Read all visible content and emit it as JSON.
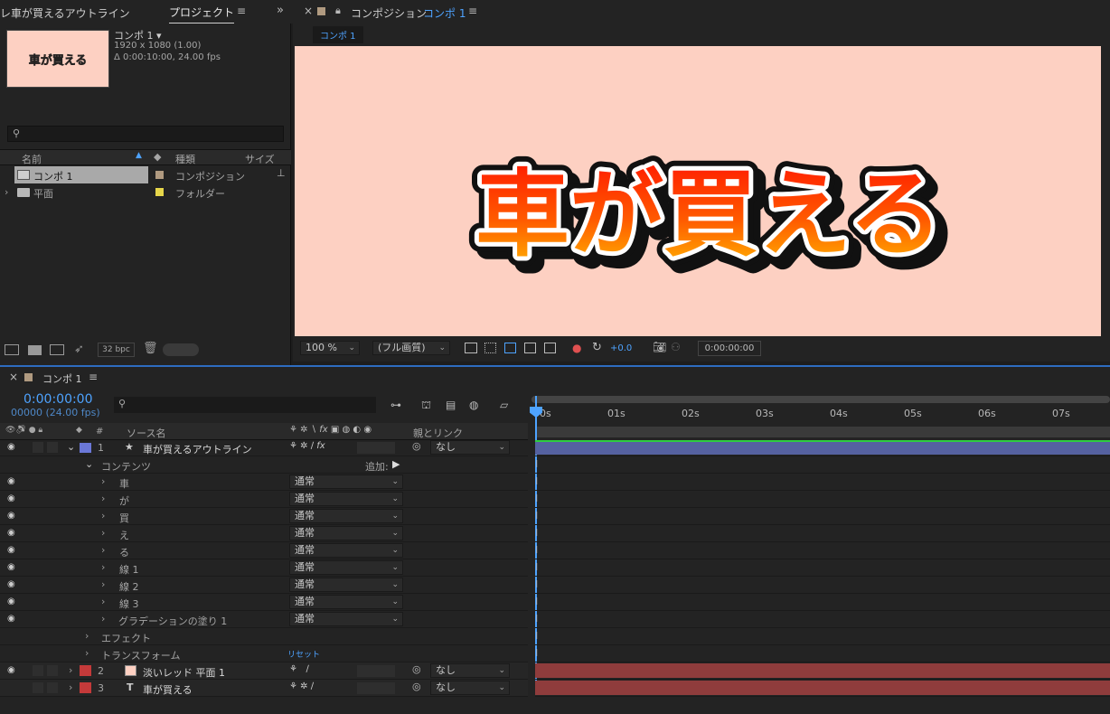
{
  "project_panel": {
    "tab_prev": "レ車が買えるアウトライン",
    "tab_active": "プロジェクト",
    "menu_icon": "hamburger-icon",
    "expand_icon": "double-chevron-icon",
    "thumb_text": "車が買える",
    "comp_name": "コンポ 1 ▾",
    "comp_res": "1920 x 1080 (1.00)",
    "comp_dur": "Δ 0:00:10:00, 24.00 fps",
    "search_placeholder": "",
    "col_name": "名前",
    "col_type": "種類",
    "col_size": "サイズ",
    "items": [
      {
        "name": "コンポ 1",
        "type": "コンポジション",
        "color": "#b09a80"
      },
      {
        "name": "平面",
        "type": "フォルダー",
        "color": "#e6d64a"
      }
    ],
    "bpc": "32 bpc"
  },
  "comp_panel": {
    "title": "コンポジション",
    "title_comp": "コンポ 1",
    "subtab": "コンポ 1",
    "canvas_text": "車が買える",
    "zoom": "100 %",
    "quality": "(フル画質)",
    "exposure": "+0.0",
    "timecode": "0:00:00:00",
    "colors": {
      "canvas_bg": "#fdd0c2"
    }
  },
  "timeline": {
    "tab": "コンポ 1",
    "timecode": "0:00:00:00",
    "frames": "00000 (24.00 fps)",
    "col_source": "ソース名",
    "col_parent": "親とリンク",
    "ruler": [
      "00s",
      "01s",
      "02s",
      "03s",
      "04s",
      "05s",
      "06s",
      "07s"
    ],
    "layers": [
      {
        "num": "1",
        "name": "車が買えるアウトライン",
        "parent": "なし",
        "color": "#6b78d8"
      },
      {
        "num": "2",
        "name": "淡いレッド 平面 1",
        "parent": "なし",
        "color": "#c43a3a"
      },
      {
        "num": "3",
        "name": "車が買える",
        "parent": "なし",
        "color": "#c43a3a"
      }
    ],
    "contents_label": "コンテンツ",
    "add_label": "追加:",
    "groups": [
      {
        "name": "車",
        "mode": "通常"
      },
      {
        "name": "が",
        "mode": "通常"
      },
      {
        "name": "買",
        "mode": "通常"
      },
      {
        "name": "え",
        "mode": "通常"
      },
      {
        "name": "る",
        "mode": "通常"
      },
      {
        "name": "線 1",
        "mode": "通常"
      },
      {
        "name": "線 2",
        "mode": "通常"
      },
      {
        "name": "線 3",
        "mode": "通常"
      },
      {
        "name": "グラデーションの塗り 1",
        "mode": "通常"
      }
    ],
    "effect_label": "エフェクト",
    "transform_label": "トランスフォーム",
    "reset_label": "リセット"
  }
}
